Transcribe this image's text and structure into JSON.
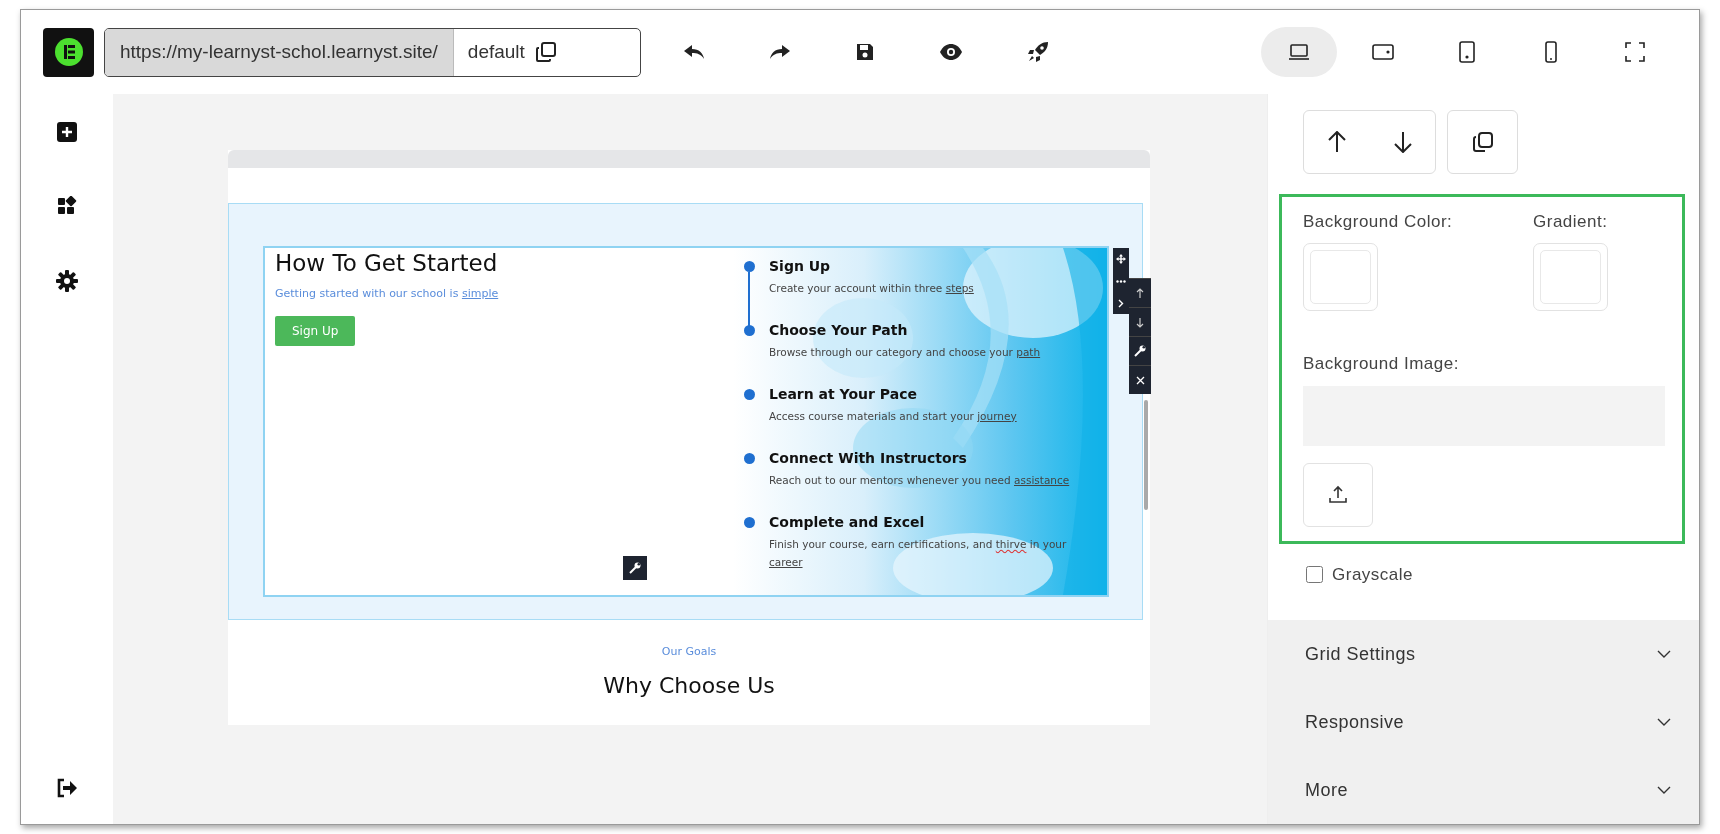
{
  "url_bar": {
    "url": "https://my-learnyst-schol.learnyst.site/",
    "page": "default"
  },
  "devices": [
    {
      "kind": "desktop",
      "selected": true
    },
    {
      "kind": "tablet-landscape",
      "selected": false
    },
    {
      "kind": "tablet",
      "selected": false
    },
    {
      "kind": "phone",
      "selected": false
    },
    {
      "kind": "fullscreen",
      "selected": false
    }
  ],
  "canvas": {
    "heading": "How To Get Started",
    "subtitle": {
      "text": "Getting started with our school is",
      "link": "simple"
    },
    "button": "Sign Up",
    "steps": [
      {
        "title": "Sign Up",
        "connected": true,
        "description": [
          {
            "kind": "plain",
            "text": "Create your account within three"
          },
          {
            "kind": "link",
            "text": "steps"
          }
        ]
      },
      {
        "title": "Choose Your Path",
        "connected": false,
        "description": [
          {
            "kind": "plain",
            "text": "Browse through our category and choose your"
          },
          {
            "kind": "link",
            "text": "path"
          }
        ]
      },
      {
        "title": "Learn at Your Pace",
        "connected": false,
        "description": [
          {
            "kind": "plain",
            "text": "Access course materials and start your"
          },
          {
            "kind": "link",
            "text": "journey"
          }
        ]
      },
      {
        "title": "Connect With Instructors",
        "connected": false,
        "description": [
          {
            "kind": "plain",
            "text": "Reach out to our mentors whenever you need"
          },
          {
            "kind": "link",
            "text": "assistance"
          }
        ]
      },
      {
        "title": "Complete and Excel",
        "connected": false,
        "description": [
          {
            "kind": "plain",
            "text": "Finish your course, earn certifications, and"
          },
          {
            "kind": "misspelled",
            "text": "thirve"
          },
          {
            "kind": "plain",
            "text": "in your"
          },
          {
            "kind": "link",
            "text": "career"
          }
        ]
      }
    ],
    "eyebrow": "Our Goals",
    "section_title": "Why Choose Us"
  },
  "panel": {
    "background_color_label": "Background Color:",
    "gradient_label": "Gradient:",
    "background_image_label": "Background Image:",
    "grayscale": {
      "label": "Grayscale",
      "checked": false
    },
    "sections": [
      {
        "label": "Grid Settings",
        "expanded": false
      },
      {
        "label": "Responsive",
        "expanded": false
      },
      {
        "label": "More",
        "expanded": false
      }
    ]
  }
}
